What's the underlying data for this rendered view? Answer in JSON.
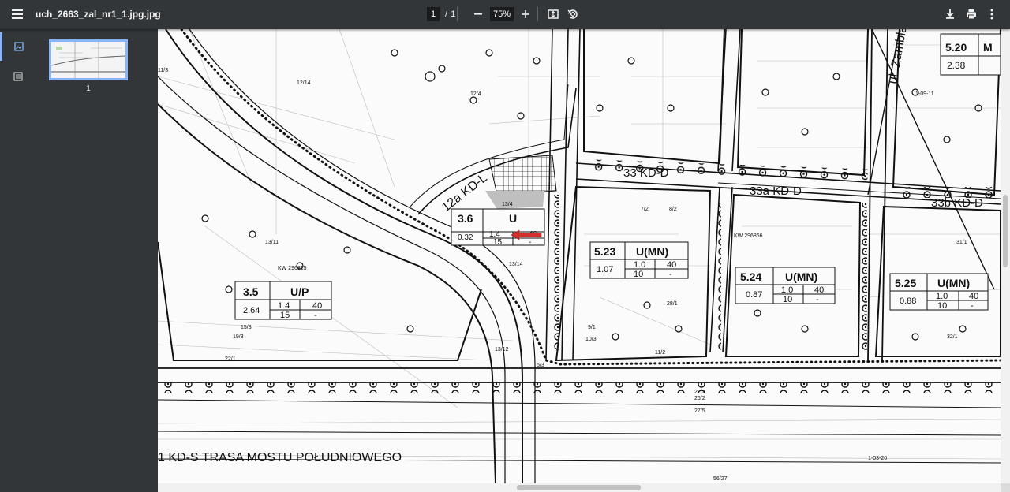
{
  "toolbar": {
    "filename": "uch_2663_zal_nr1_1.jpg.jpg",
    "current_page": "1",
    "page_separator": "/",
    "total_pages": "1",
    "zoom": "75%",
    "icons": [
      "menu-icon",
      "zoom-out-icon",
      "zoom-in-icon",
      "fit-page-icon",
      "rotate-icon",
      "download-icon",
      "print-icon",
      "more-vert-icon"
    ]
  },
  "sidebar": {
    "tabs": [
      "thumbnails-icon",
      "outline-icon"
    ],
    "thumbnail_number": "1"
  },
  "map": {
    "roads": {
      "r12a": "12a KD-L",
      "r33": "33 KD-D",
      "r33a": "33a KD-D",
      "r33b": "33b KD-D",
      "r1": "1 KD-S  TRASA MOSTU POŁUDNIOWEGO",
      "street": "ul. Zambla"
    },
    "zones": [
      {
        "id": "3.6",
        "use": "U",
        "area": "0.32",
        "v1": "1.4",
        "v2": "40",
        "v3": "15",
        "v4": "-"
      },
      {
        "id": "3.5",
        "use": "U/P",
        "area": "2.64",
        "v1": "1.4",
        "v2": "40",
        "v3": "15",
        "v4": "-"
      },
      {
        "id": "5.23",
        "use": "U(MN)",
        "area": "1.07",
        "v1": "1.0",
        "v2": "40",
        "v3": "10",
        "v4": "-"
      },
      {
        "id": "5.24",
        "use": "U(MN)",
        "area": "0.87",
        "v1": "1.0",
        "v2": "40",
        "v3": "10",
        "v4": "-"
      },
      {
        "id": "5.25",
        "use": "U(MN)",
        "area": "0.88",
        "v1": "1.0",
        "v2": "40",
        "v3": "10",
        "v4": "-"
      },
      {
        "id": "5.20",
        "use": "M",
        "area": "2.38",
        "v1": "",
        "v2": "",
        "v3": "",
        "v4": ""
      }
    ],
    "parcel_labels": [
      "13/4",
      "13/11",
      "13/14",
      "13/12",
      "12/4",
      "11/3",
      "12/14",
      "15/3",
      "19/3",
      "22/1",
      "7/2",
      "8/2",
      "9/1",
      "10/3",
      "11/2",
      "28/1",
      "26/2",
      "27/2",
      "27/5",
      "56/27",
      "31/1",
      "32/1",
      "6/3",
      "KW 296815",
      "KW 296866",
      "1-09-11",
      "1-03-20"
    ],
    "arrow_color": "#d32f2f"
  }
}
